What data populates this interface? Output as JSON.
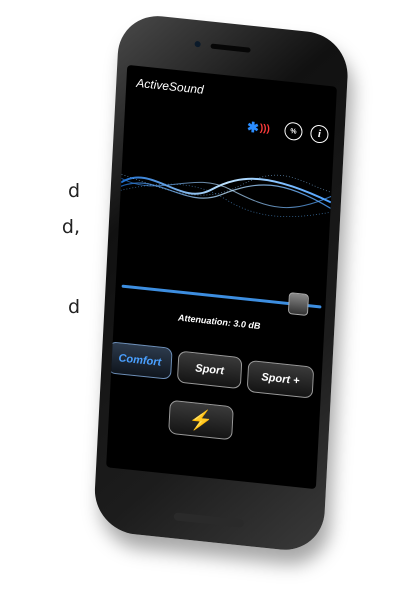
{
  "side_text": [
    "d",
    "d,",
    "d"
  ],
  "app": {
    "title": "ActiveSound",
    "attenuation_label": "Attenuation: 3.0 dB",
    "slider_level": 0.88,
    "buttons": {
      "comfort": "Comfort",
      "sport": "Sport",
      "sport_plus": "Sport +"
    },
    "active_mode": "comfort",
    "icons": {
      "bluetooth": "bluetooth-icon",
      "percent": "percent-icon",
      "info": "info-icon",
      "boost": "lightning-bolt-icon"
    },
    "colors": {
      "accent": "#3d8ee0",
      "active_text": "#4aa0ff",
      "screen_bg": "#000000"
    }
  }
}
